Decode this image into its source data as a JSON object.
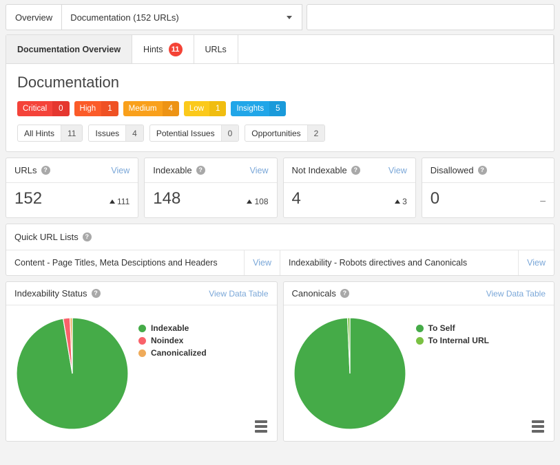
{
  "topbar": {
    "overview_label": "Overview",
    "selected_project": "Documentation (152 URLs)",
    "caret_icon": "chevron-down-icon"
  },
  "tabs": [
    {
      "label": "Documentation Overview",
      "badge": null,
      "active": true
    },
    {
      "label": "Hints",
      "badge": "11",
      "active": false
    },
    {
      "label": "URLs",
      "badge": null,
      "active": false
    }
  ],
  "documentation": {
    "title": "Documentation",
    "severities": [
      {
        "label": "Critical",
        "count": "0",
        "color": "#f4433a",
        "count_color": "#e5372f"
      },
      {
        "label": "High",
        "count": "1",
        "color": "#fb5b29",
        "count_color": "#ef5124"
      },
      {
        "label": "Medium",
        "count": "4",
        "color": "#f9a01b",
        "count_color": "#ed9314"
      },
      {
        "label": "Low",
        "count": "1",
        "color": "#fbc91b",
        "count_color": "#f0bd10"
      },
      {
        "label": "Insights",
        "count": "5",
        "color": "#21a6e8",
        "count_color": "#1a9ada"
      }
    ],
    "filters": [
      {
        "label": "All Hints",
        "count": "11"
      },
      {
        "label": "Issues",
        "count": "4"
      },
      {
        "label": "Potential Issues",
        "count": "0"
      },
      {
        "label": "Opportunities",
        "count": "2"
      }
    ]
  },
  "metrics": [
    {
      "title": "URLs",
      "value": "152",
      "delta": "111",
      "has_delta": true,
      "view_label": "View",
      "has_view": true
    },
    {
      "title": "Indexable",
      "value": "148",
      "delta": "108",
      "has_delta": true,
      "view_label": "View",
      "has_view": true
    },
    {
      "title": "Not Indexable",
      "value": "4",
      "delta": "3",
      "has_delta": true,
      "view_label": "View",
      "has_view": true
    },
    {
      "title": "Disallowed",
      "value": "0",
      "delta": "–",
      "has_delta": false,
      "view_label": "",
      "has_view": false
    }
  ],
  "quick_lists": {
    "title": "Quick URL Lists",
    "items": [
      {
        "label": "Content - Page Titles, Meta Desciptions and Headers",
        "view_label": "View"
      },
      {
        "label": "Indexability - Robots directives and Canonicals",
        "view_label": "View"
      }
    ]
  },
  "chart_data": [
    {
      "type": "pie",
      "title": "Indexability Status",
      "link_label": "View Data Table",
      "categories": [
        "Indexable",
        "Noindex",
        "Canonicalized"
      ],
      "values": [
        148,
        3,
        1
      ],
      "colors": [
        "#45ab48",
        "#f9626a",
        "#efab5a"
      ],
      "legend_position": "right",
      "menu_icon": "hamburger-menu-icon"
    },
    {
      "type": "pie",
      "title": "Canonicals",
      "link_label": "View Data Table",
      "categories": [
        "To Self",
        "To Internal URL"
      ],
      "values": [
        147,
        1
      ],
      "colors": [
        "#45ab48",
        "#7ac143"
      ],
      "legend_position": "right",
      "menu_icon": "hamburger-menu-icon"
    }
  ]
}
